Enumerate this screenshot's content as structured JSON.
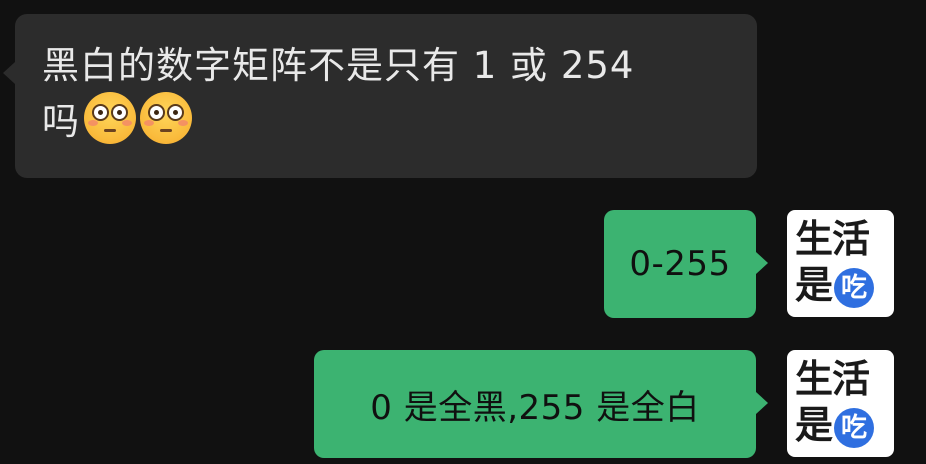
{
  "messages": [
    {
      "direction": "incoming",
      "text_line1": "黑白的数字矩阵不是只有 1 或 254",
      "text_line2": "吗",
      "emojis": [
        "flushed-face-icon",
        "flushed-face-icon"
      ]
    },
    {
      "direction": "outgoing",
      "text": "0-255",
      "avatar": {
        "line1": "生活",
        "line2": "是",
        "badge": "吃"
      }
    },
    {
      "direction": "outgoing",
      "text": "0 是全黑,255 是全白",
      "avatar": {
        "line1": "生活",
        "line2": "是",
        "badge": "吃"
      }
    }
  ],
  "colors": {
    "background": "#111111",
    "incoming_bubble": "#2c2c2c",
    "outgoing_bubble": "#3cb371",
    "avatar_badge": "#2f6fe0"
  }
}
